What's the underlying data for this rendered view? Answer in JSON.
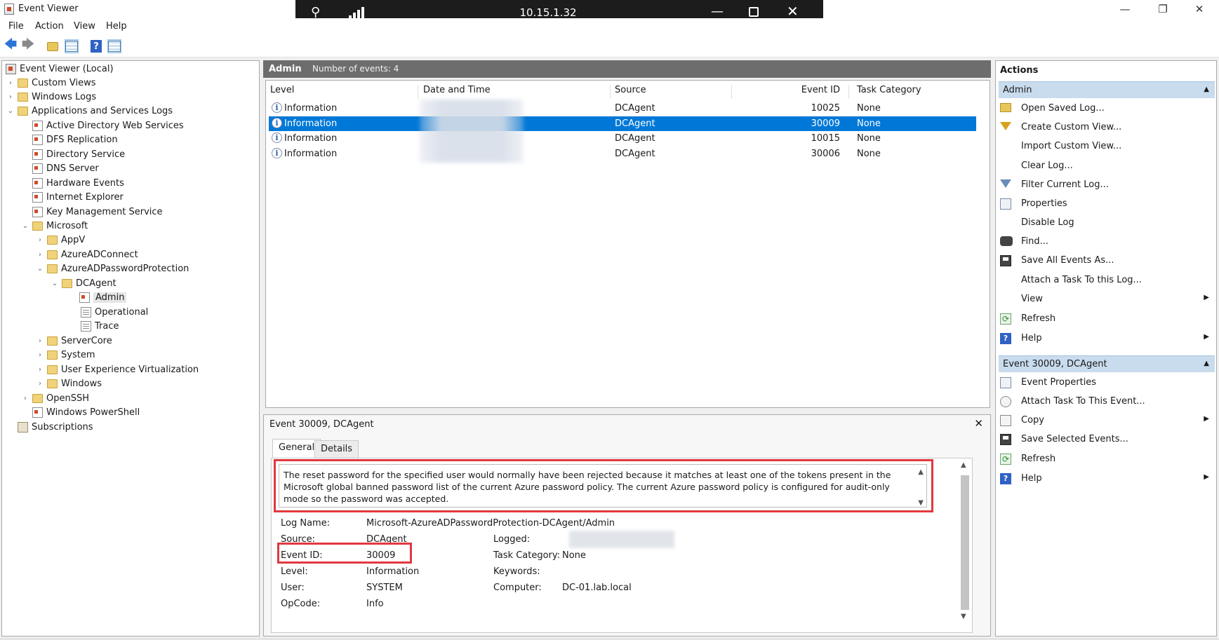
{
  "window": {
    "title": "Event Viewer",
    "controls": {
      "minimize": "—",
      "maximize": "❐",
      "close": "✕"
    }
  },
  "remote": {
    "ip": "10.15.1.32",
    "minimize": "—",
    "close": "✕"
  },
  "menu": [
    "File",
    "Action",
    "View",
    "Help"
  ],
  "tree": [
    {
      "label": "Event Viewer (Local)",
      "icon": "event-viewer-icon"
    },
    {
      "label": "Custom Views",
      "icon": "folder-icon",
      "expander": "›"
    },
    {
      "label": "Windows Logs",
      "icon": "folder-icon",
      "expander": "›"
    },
    {
      "label": "Applications and Services Logs",
      "icon": "folder-icon",
      "expander": "⌄"
    },
    {
      "label": "Active Directory Web Services",
      "icon": "log-icon"
    },
    {
      "label": "DFS Replication",
      "icon": "log-icon"
    },
    {
      "label": "Directory Service",
      "icon": "log-icon"
    },
    {
      "label": "DNS Server",
      "icon": "log-icon"
    },
    {
      "label": "Hardware Events",
      "icon": "log-icon"
    },
    {
      "label": "Internet Explorer",
      "icon": "log-icon"
    },
    {
      "label": "Key Management Service",
      "icon": "log-icon"
    },
    {
      "label": "Microsoft",
      "icon": "folder-icon",
      "expander": "⌄"
    },
    {
      "label": "AppV",
      "icon": "folder-icon",
      "expander": "›"
    },
    {
      "label": "AzureADConnect",
      "icon": "folder-icon",
      "expander": "›"
    },
    {
      "label": "AzureADPasswordProtection",
      "icon": "folder-icon",
      "expander": "⌄"
    },
    {
      "label": "DCAgent",
      "icon": "folder-icon",
      "expander": "⌄"
    },
    {
      "label": "Admin",
      "icon": "log-icon",
      "selected": true
    },
    {
      "label": "Operational",
      "icon": "log-plain-icon"
    },
    {
      "label": "Trace",
      "icon": "log-plain-icon"
    },
    {
      "label": "ServerCore",
      "icon": "folder-icon",
      "expander": "›"
    },
    {
      "label": "System",
      "icon": "folder-icon",
      "expander": "›"
    },
    {
      "label": "User Experience Virtualization",
      "icon": "folder-icon",
      "expander": "›"
    },
    {
      "label": "Windows",
      "icon": "folder-icon",
      "expander": "›"
    },
    {
      "label": "OpenSSH",
      "icon": "folder-icon",
      "expander": "›"
    },
    {
      "label": "Windows PowerShell",
      "icon": "log-icon"
    },
    {
      "label": "Subscriptions",
      "icon": "subscriptions-icon"
    }
  ],
  "center": {
    "title": "Admin",
    "count": "Number of events: 4"
  },
  "columns": {
    "level": "Level",
    "date": "Date and Time",
    "source": "Source",
    "event_id": "Event ID",
    "task": "Task Category"
  },
  "events": [
    {
      "level": "Information",
      "source": "DCAgent",
      "event_id": "10025",
      "task": "None",
      "selected": false
    },
    {
      "level": "Information",
      "source": "DCAgent",
      "event_id": "30009",
      "task": "None",
      "selected": true
    },
    {
      "level": "Information",
      "source": "DCAgent",
      "event_id": "10015",
      "task": "None",
      "selected": false
    },
    {
      "level": "Information",
      "source": "DCAgent",
      "event_id": "30006",
      "task": "None",
      "selected": false
    }
  ],
  "detail": {
    "title": "Event 30009, DCAgent",
    "close": "✕",
    "tabs": [
      "General",
      "Details"
    ],
    "description": "The reset password for the specified user would normally have been rejected because it matches at least one of the tokens present in the Microsoft global banned password list of the current Azure password policy. The current Azure password policy is configured for audit-only mode so the password was accepted.",
    "labels": {
      "log_name": "Log Name:",
      "source": "Source:",
      "event_id": "Event ID:",
      "level": "Level:",
      "user": "User:",
      "opcode": "OpCode:",
      "logged": "Logged:",
      "task_category": "Task Category:",
      "keywords": "Keywords:",
      "computer": "Computer:"
    },
    "values": {
      "log_name": "Microsoft-AzureADPasswordProtection-DCAgent/Admin",
      "source": "DCAgent",
      "event_id": "30009",
      "level": "Information",
      "user": "SYSTEM",
      "opcode": "Info",
      "task_category": "None",
      "computer": "DC-01.lab.local"
    },
    "highlight_color": "#e0393e"
  },
  "actions": {
    "header": "Actions",
    "section1": "Admin",
    "section1_items": [
      {
        "label": "Open Saved Log...",
        "icon": "open-log-icon"
      },
      {
        "label": "Create Custom View...",
        "icon": "filter-icon"
      },
      {
        "label": "Import Custom View...",
        "icon": ""
      },
      {
        "label": "Clear Log...",
        "icon": ""
      },
      {
        "label": "Filter Current Log...",
        "icon": "filter-icon"
      },
      {
        "label": "Properties",
        "icon": "properties-icon"
      },
      {
        "label": "Disable Log",
        "icon": ""
      },
      {
        "label": "Find...",
        "icon": "find-icon"
      },
      {
        "label": "Save All Events As...",
        "icon": "save-icon"
      },
      {
        "label": "Attach a Task To this Log...",
        "icon": ""
      },
      {
        "label": "View",
        "icon": "",
        "submenu": true
      },
      {
        "label": "Refresh",
        "icon": "refresh-icon"
      },
      {
        "label": "Help",
        "icon": "help-icon",
        "submenu": true
      }
    ],
    "section2": "Event 30009, DCAgent",
    "section2_items": [
      {
        "label": "Event Properties",
        "icon": "properties-icon"
      },
      {
        "label": "Attach Task To This Event...",
        "icon": "attach-task-icon"
      },
      {
        "label": "Copy",
        "icon": "copy-icon",
        "submenu": true
      },
      {
        "label": "Save Selected Events...",
        "icon": "save-icon"
      },
      {
        "label": "Refresh",
        "icon": "refresh-icon"
      },
      {
        "label": "Help",
        "icon": "help-icon",
        "submenu": true
      }
    ]
  },
  "colors": {
    "selection": "#0078d7",
    "header_bar": "#6d6d6d",
    "section_bar": "#c9dcee"
  }
}
